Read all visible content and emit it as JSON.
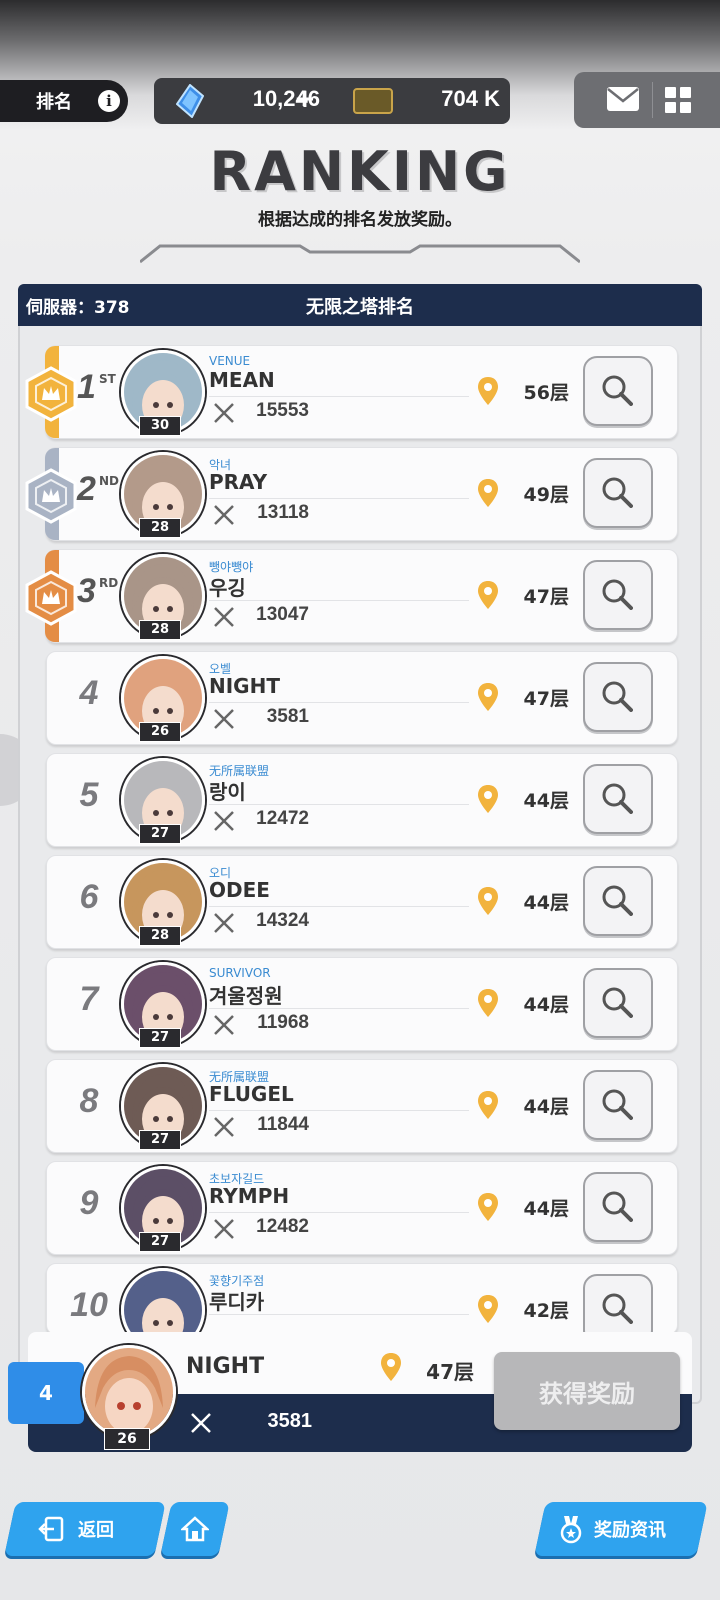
{
  "topbar": {
    "tab_label": "排名",
    "gems": "10,246",
    "gems_plus": "+",
    "tickets": "704 K"
  },
  "header": {
    "title": "RANKING",
    "subtitle": "根据达成的排名发放奖励。"
  },
  "board": {
    "server": "伺服器：378",
    "title": "无限之塔排名"
  },
  "rows": [
    {
      "rank": "1",
      "suffix": "ST",
      "guild": "VENUE",
      "name": "MEAN",
      "level": "30",
      "power": "15553",
      "floor": "56层"
    },
    {
      "rank": "2",
      "suffix": "ND",
      "guild": "악녀",
      "name": "PRAY",
      "level": "28",
      "power": "13118",
      "floor": "49层"
    },
    {
      "rank": "3",
      "suffix": "RD",
      "guild": "뺑야뺑야",
      "name": "우깅",
      "level": "28",
      "power": "13047",
      "floor": "47层"
    },
    {
      "rank": "4",
      "guild": "오벨",
      "name": "NIGHT",
      "level": "26",
      "power": "3581",
      "floor": "47层"
    },
    {
      "rank": "5",
      "guild": "无所属联盟",
      "name": "랑이",
      "level": "27",
      "power": "12472",
      "floor": "44层"
    },
    {
      "rank": "6",
      "guild": "오디",
      "name": "ODEE",
      "level": "28",
      "power": "14324",
      "floor": "44层"
    },
    {
      "rank": "7",
      "guild": "SURVIVOR",
      "name": "겨울정원",
      "level": "27",
      "power": "11968",
      "floor": "44层"
    },
    {
      "rank": "8",
      "guild": "无所属联盟",
      "name": "FLUGEL",
      "level": "27",
      "power": "11844",
      "floor": "44层"
    },
    {
      "rank": "9",
      "guild": "초보자길드",
      "name": "RYMPH",
      "level": "27",
      "power": "12482",
      "floor": "44层"
    },
    {
      "rank": "10",
      "guild": "꽃향기주점",
      "name": "루디카",
      "level": "",
      "power": "",
      "floor": "42层"
    }
  ],
  "my_rank": {
    "rank": "4",
    "name": "NIGHT",
    "level": "26",
    "floor": "47层",
    "power": "3581",
    "claim_label": "获得奖励"
  },
  "nav": {
    "back_label": "返回",
    "reward_info_label": "奖励资讯"
  },
  "colors": {
    "navy": "#1d2d4c",
    "gold": "#f2b33d",
    "silver": "#a9b3c4",
    "bronze": "#e48d45",
    "button_blue": "#2fa3ee",
    "guild_blue": "#3a8bd1"
  },
  "avatar_palette": [
    "#9fb8c8",
    "#b39a8a",
    "#a99588",
    "#e0a27e",
    "#b8b8bb",
    "#c7965d",
    "#6b4f6a",
    "#6e5b55",
    "#5c4f66",
    "#54608a"
  ]
}
